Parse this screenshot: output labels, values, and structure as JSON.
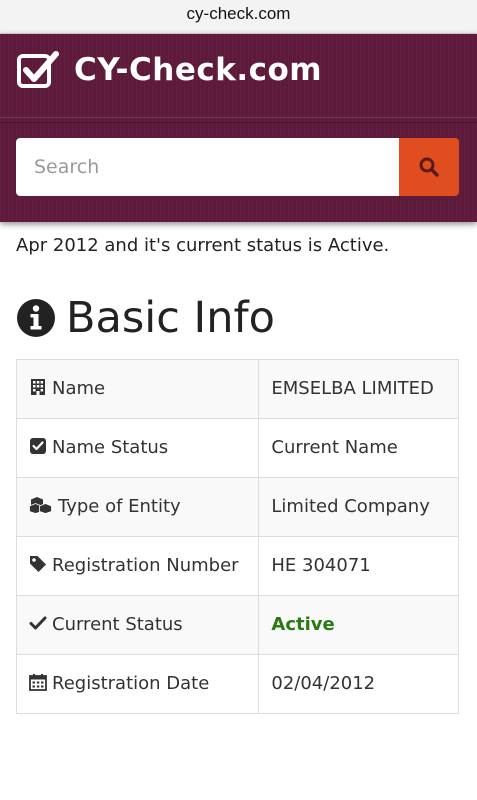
{
  "browser": {
    "url": "cy-check.com"
  },
  "header": {
    "site_name": "CY-Check.com",
    "logo_icon": "checkbox-icon",
    "background_color": "#5e1a3b"
  },
  "search": {
    "placeholder": "Search",
    "value": "",
    "button_icon": "search-icon",
    "button_color": "#e04e1f"
  },
  "intro_text": "Apr 2012 and it's current status is Active.",
  "section": {
    "icon": "info-circle-icon",
    "title": "Basic Info"
  },
  "basic_info": {
    "name": {
      "label": "Name",
      "icon": "building-icon",
      "value": "EMSELBA LIMITED"
    },
    "name_status": {
      "label": "Name Status",
      "icon": "check-square-icon",
      "value": "Current Name"
    },
    "entity_type": {
      "label": "Type of Entity",
      "icon": "cubes-icon",
      "value": "Limited Company"
    },
    "registration_number": {
      "label": "Registration Number",
      "icon": "tag-icon",
      "value": "HE 304071"
    },
    "current_status": {
      "label": "Current Status",
      "icon": "checkmark-icon",
      "value": "Active",
      "value_color": "#2a7a14"
    },
    "registration_date": {
      "label": "Registration Date",
      "icon": "calendar-icon",
      "value": "02/04/2012"
    }
  }
}
